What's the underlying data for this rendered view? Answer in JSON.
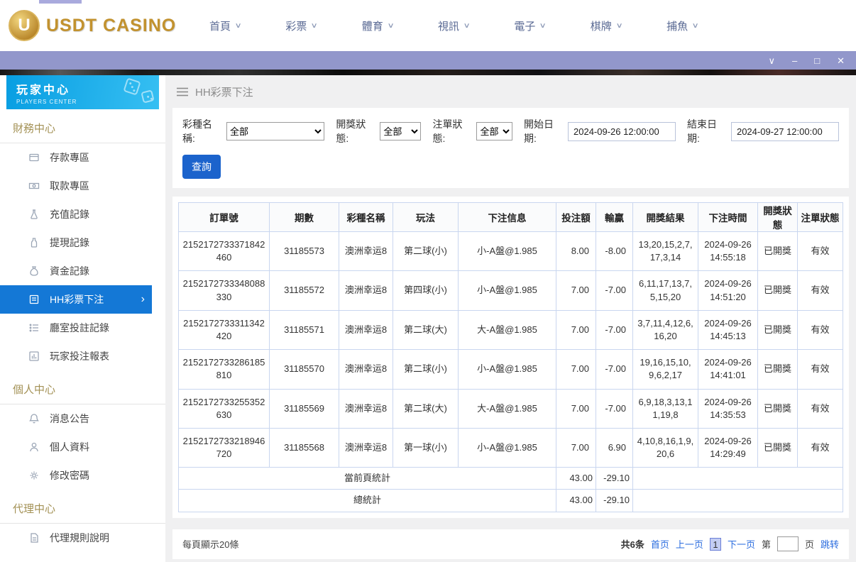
{
  "icons": {
    "chevron_down": "∨",
    "window_min": "–",
    "window_max": "□",
    "window_close": "✕",
    "arrow_right": "›"
  },
  "topnav": {
    "logo_badge": "U",
    "logo": "USDT CASINO",
    "items": [
      "首頁",
      "彩票",
      "體育",
      "視訊",
      "電子",
      "棋牌",
      "捕魚"
    ]
  },
  "sidebar": {
    "title": "玩家中心",
    "subtitle": "PLAYERS CENTER",
    "finance_section": "財務中心",
    "finance_items": [
      "存款專區",
      "取款專區",
      "充值記錄",
      "提現記錄",
      "資金記錄",
      "HH彩票下注",
      "廳室投註記錄",
      "玩家投注報表"
    ],
    "personal_section": "個人中心",
    "personal_items": [
      "消息公告",
      "個人資料",
      "修改密碼"
    ],
    "agent_section": "代理中心",
    "agent_items": [
      "代理規則說明"
    ],
    "active_item": "HH彩票下注"
  },
  "main": {
    "breadcrumb": "HH彩票下注",
    "filters": {
      "lottery_label": "彩種名稱:",
      "lottery_value": "全部",
      "draw_label": "開獎狀態:",
      "draw_value": "全部",
      "status_label": "注單狀態:",
      "status_value": "全部",
      "start_label": "開始日期:",
      "start_value": "2024-09-26 12:00:00",
      "end_label": "結束日期:",
      "end_value": "2024-09-27 12:00:00",
      "search": "查詢"
    },
    "table": {
      "headers": [
        "訂單號",
        "期數",
        "彩種名稱",
        "玩法",
        "下注信息",
        "投注額",
        "輸贏",
        "開獎結果",
        "下注時間",
        "開獎狀態",
        "注單狀態"
      ],
      "rows": [
        {
          "order": "2152172733371842460",
          "period": "31185573",
          "lottery": "澳洲幸运8",
          "play": "第二球(小)",
          "info": "小-A盤@1.985",
          "amount": "8.00",
          "winloss": "-8.00",
          "result": "13,20,15,2,7,17,3,14",
          "time": "2024-09-26 14:55:18",
          "draw_status": "已開獎",
          "order_status": "有效"
        },
        {
          "order": "2152172733348088330",
          "period": "31185572",
          "lottery": "澳洲幸运8",
          "play": "第四球(小)",
          "info": "小-A盤@1.985",
          "amount": "7.00",
          "winloss": "-7.00",
          "result": "6,11,17,13,7,5,15,20",
          "time": "2024-09-26 14:51:20",
          "draw_status": "已開獎",
          "order_status": "有效"
        },
        {
          "order": "2152172733311342420",
          "period": "31185571",
          "lottery": "澳洲幸运8",
          "play": "第二球(大)",
          "info": "大-A盤@1.985",
          "amount": "7.00",
          "winloss": "-7.00",
          "result": "3,7,11,4,12,6,16,20",
          "time": "2024-09-26 14:45:13",
          "draw_status": "已開獎",
          "order_status": "有效"
        },
        {
          "order": "2152172733286185810",
          "period": "31185570",
          "lottery": "澳洲幸运8",
          "play": "第二球(小)",
          "info": "小-A盤@1.985",
          "amount": "7.00",
          "winloss": "-7.00",
          "result": "19,16,15,10,9,6,2,17",
          "time": "2024-09-26 14:41:01",
          "draw_status": "已開獎",
          "order_status": "有效"
        },
        {
          "order": "2152172733255352630",
          "period": "31185569",
          "lottery": "澳洲幸运8",
          "play": "第二球(大)",
          "info": "大-A盤@1.985",
          "amount": "7.00",
          "winloss": "-7.00",
          "result": "6,9,18,3,13,11,19,8",
          "time": "2024-09-26 14:35:53",
          "draw_status": "已開獎",
          "order_status": "有效"
        },
        {
          "order": "2152172733218946720",
          "period": "31185568",
          "lottery": "澳洲幸运8",
          "play": "第一球(小)",
          "info": "小-A盤@1.985",
          "amount": "7.00",
          "winloss": "6.90",
          "result": "4,10,8,16,1,9,20,6",
          "time": "2024-09-26 14:29:49",
          "draw_status": "已開獎",
          "order_status": "有效"
        }
      ],
      "page_summary": {
        "label": "當前頁統計",
        "amount": "43.00",
        "winloss": "-29.10"
      },
      "total_summary": {
        "label": "總統計",
        "amount": "43.00",
        "winloss": "-29.10"
      }
    },
    "pager": {
      "per_page": "每頁顯示20條",
      "total": "共6条",
      "first": "首页",
      "prev": "上一页",
      "current": "1",
      "next": "下一页",
      "page_word_before": "第",
      "page_word_after": "页",
      "jump": "跳转"
    }
  }
}
